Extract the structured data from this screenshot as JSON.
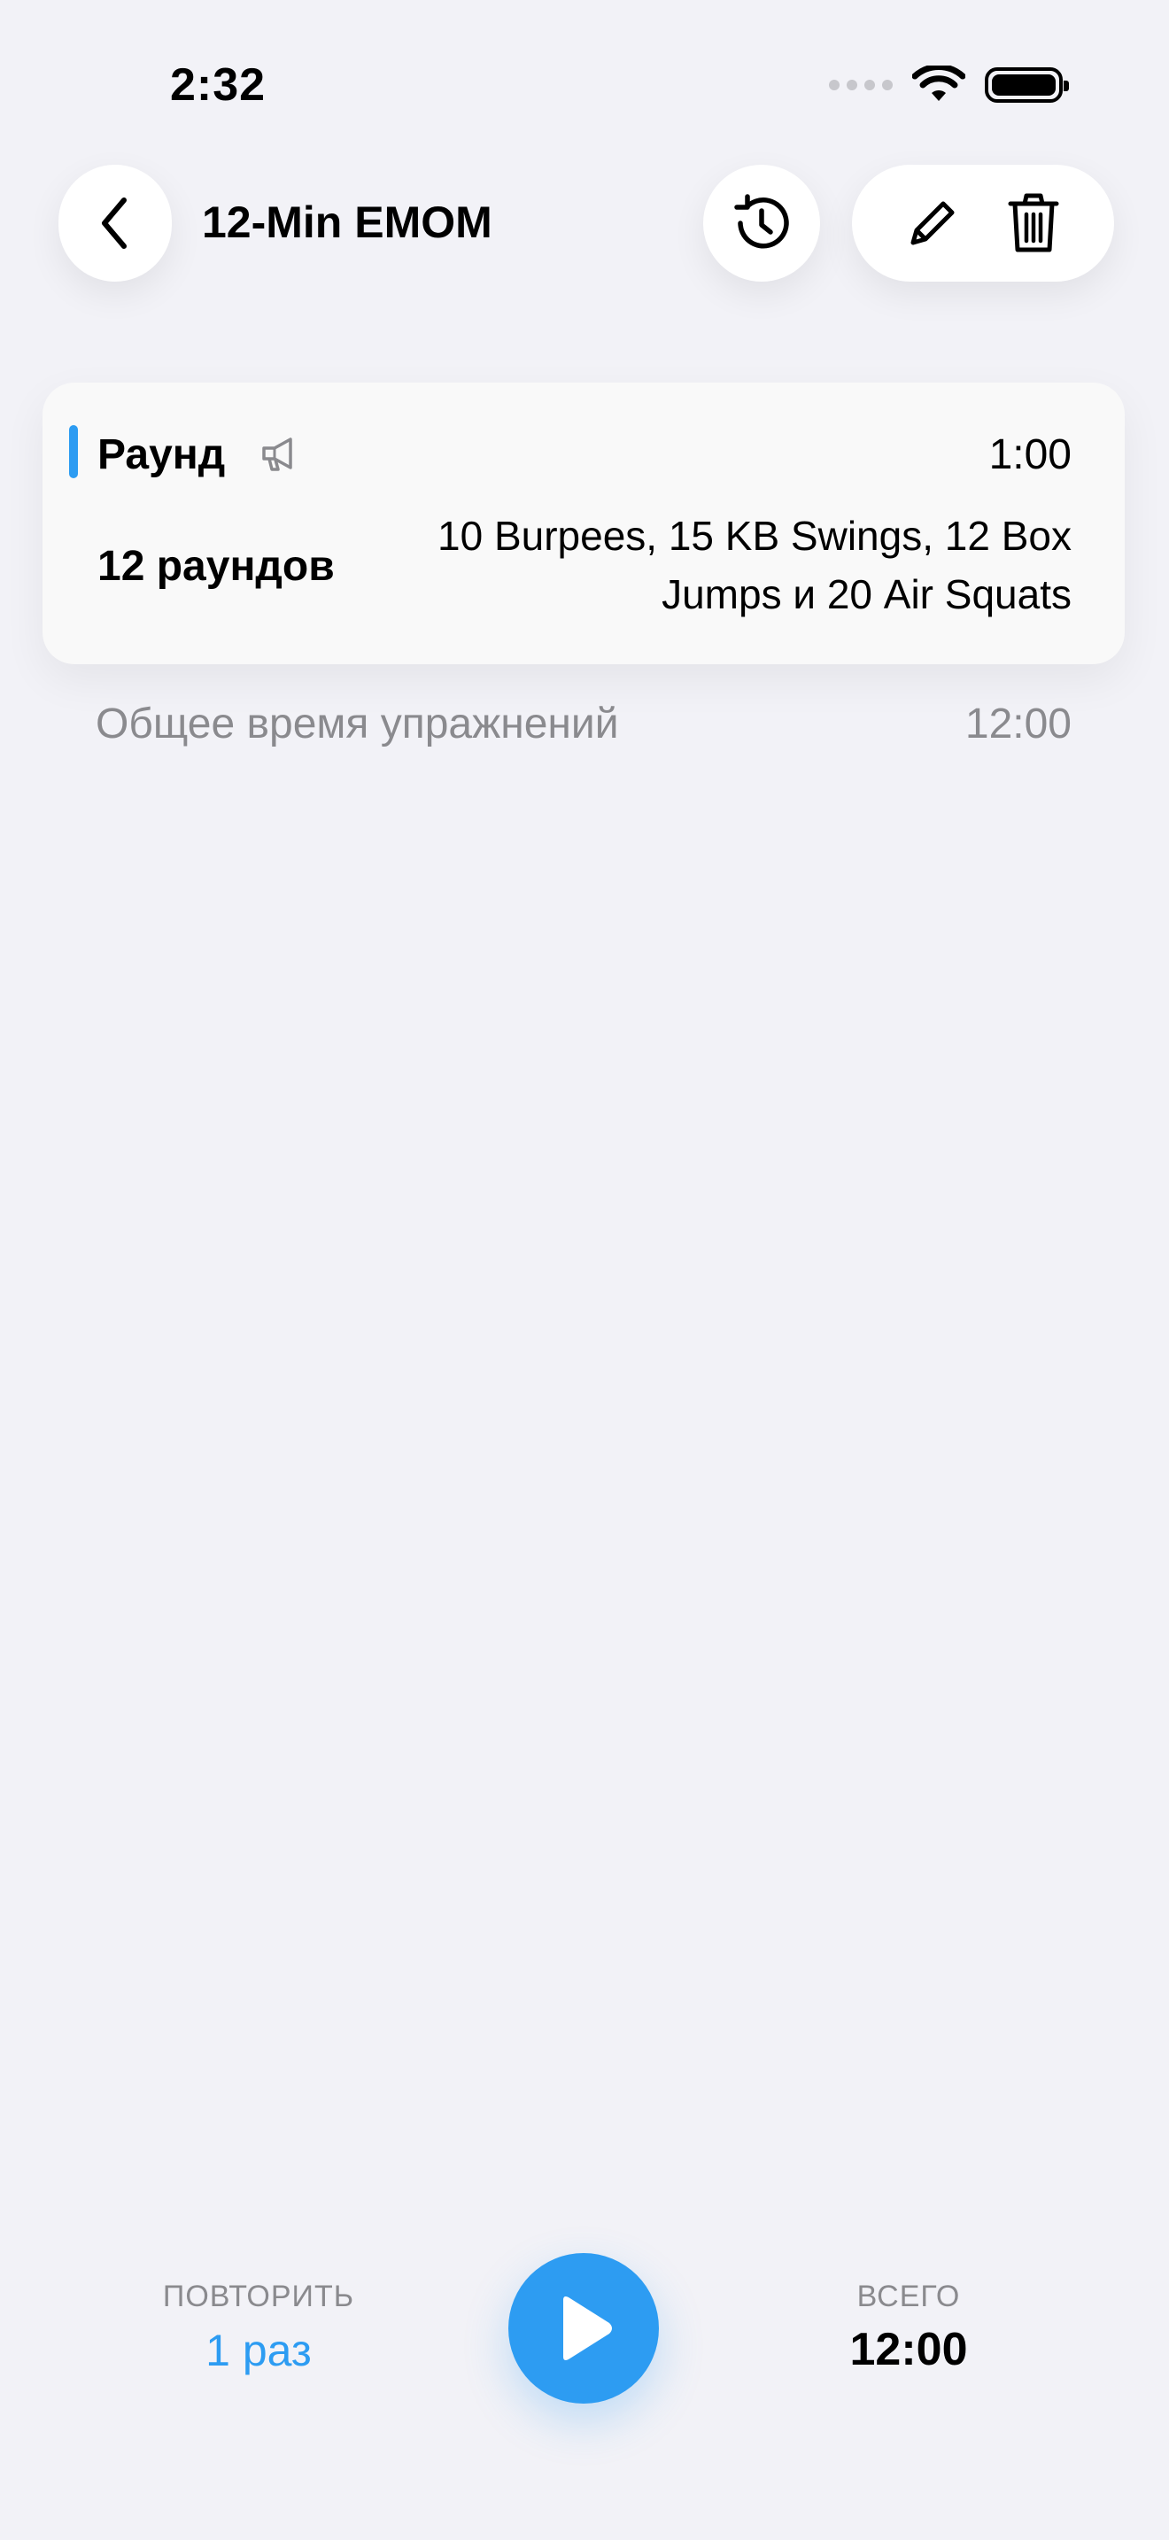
{
  "status_bar": {
    "time": "2:32"
  },
  "nav": {
    "title": "12-Min EMOM",
    "icons": [
      "chevron-left-icon",
      "history-icon",
      "pencil-icon",
      "trash-icon"
    ]
  },
  "interval": {
    "label": "Раунд",
    "duration": "1:00",
    "rounds": "12 раундов",
    "exercises": "10 Burpees, 15 KB Swings, 12 Box Jumps и 20 Air Squats",
    "accent_color": "#2d9cf2",
    "cue_icon": "megaphone-icon"
  },
  "summary": {
    "label": "Общее время упражнений",
    "value": "12:00"
  },
  "footer": {
    "repeat_caption": "ПОВТОРИТЬ",
    "repeat_value": "1 раз",
    "total_caption": "ВСЕГО",
    "total_value": "12:00",
    "play_icon": "play-icon"
  }
}
